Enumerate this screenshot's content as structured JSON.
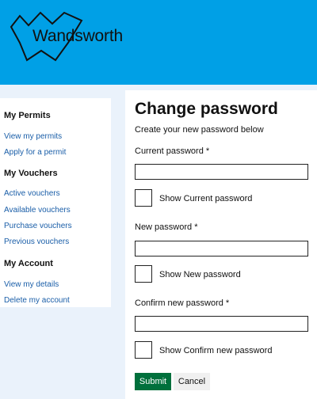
{
  "brand": {
    "name": "Wandsworth",
    "header_color": "#00a0e6"
  },
  "sidebar": {
    "sections": [
      {
        "heading": "My Permits",
        "links": [
          "View my permits",
          "Apply for a permit"
        ]
      },
      {
        "heading": "My Vouchers",
        "links": [
          "Active vouchers",
          "Available vouchers",
          "Purchase vouchers",
          "Previous vouchers"
        ]
      },
      {
        "heading": "My Account",
        "links": [
          "View my details",
          "Delete my account"
        ]
      }
    ]
  },
  "main": {
    "title": "Change password",
    "intro": "Create your new password below",
    "fields": [
      {
        "label": "Current password *",
        "value": "",
        "show_label": "Show Current password"
      },
      {
        "label": "New password *",
        "value": "",
        "show_label": "Show New password"
      },
      {
        "label": "Confirm new password *",
        "value": "",
        "show_label": "Show Confirm new password"
      }
    ],
    "submit_label": "Submit",
    "cancel_label": "Cancel",
    "submit_color": "#00703c"
  }
}
